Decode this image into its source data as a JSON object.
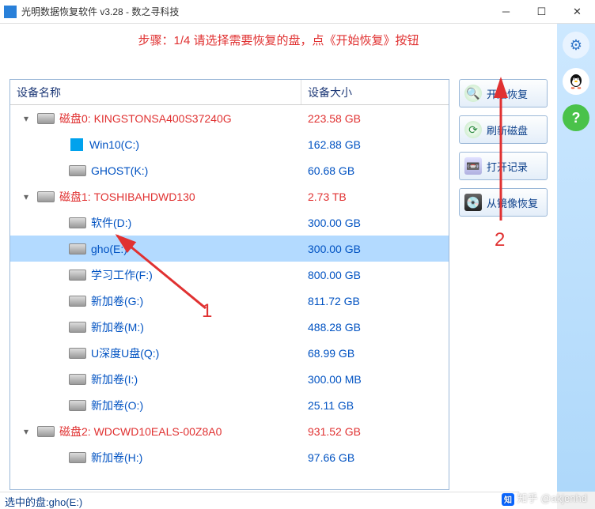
{
  "window": {
    "title": "光明数据恢复软件 v3.28 - 数之寻科技"
  },
  "step_text": "步骤：1/4 请选择需要恢复的盘，点《开始恢复》按钮",
  "columns": {
    "name": "设备名称",
    "size": "设备大小"
  },
  "tree": [
    {
      "type": "disk",
      "chev": "▾",
      "label": "磁盘0: KINGSTONSA400S37240G",
      "size": "223.58 GB",
      "indent": 0,
      "icon": "disk"
    },
    {
      "type": "part",
      "chev": "",
      "label": "Win10(C:)",
      "size": "162.88 GB",
      "indent": 1,
      "icon": "win"
    },
    {
      "type": "part",
      "chev": "",
      "label": "GHOST(K:)",
      "size": "60.68 GB",
      "indent": 1,
      "icon": "disk"
    },
    {
      "type": "disk",
      "chev": "▾",
      "label": "磁盘1: TOSHIBAHDWD130",
      "size": "2.73 TB",
      "indent": 0,
      "icon": "disk"
    },
    {
      "type": "part",
      "chev": "",
      "label": "软件(D:)",
      "size": "300.00 GB",
      "indent": 1,
      "icon": "disk"
    },
    {
      "type": "part",
      "chev": "",
      "label": "gho(E:)",
      "size": "300.00 GB",
      "indent": 1,
      "icon": "disk",
      "selected": true
    },
    {
      "type": "part",
      "chev": "",
      "label": "学习工作(F:)",
      "size": "800.00 GB",
      "indent": 1,
      "icon": "disk"
    },
    {
      "type": "part",
      "chev": "",
      "label": "新加卷(G:)",
      "size": "811.72 GB",
      "indent": 1,
      "icon": "disk"
    },
    {
      "type": "part",
      "chev": "",
      "label": "新加卷(M:)",
      "size": "488.28 GB",
      "indent": 1,
      "icon": "disk"
    },
    {
      "type": "part",
      "chev": "",
      "label": "U深度U盘(Q:)",
      "size": "68.99 GB",
      "indent": 1,
      "icon": "disk"
    },
    {
      "type": "part",
      "chev": "",
      "label": "新加卷(I:)",
      "size": "300.00 MB",
      "indent": 1,
      "icon": "disk"
    },
    {
      "type": "part",
      "chev": "",
      "label": "新加卷(O:)",
      "size": "25.11 GB",
      "indent": 1,
      "icon": "disk"
    },
    {
      "type": "disk",
      "chev": "▾",
      "label": "磁盘2: WDCWD10EALS-00Z8A0",
      "size": "931.52 GB",
      "indent": 0,
      "icon": "disk"
    },
    {
      "type": "part",
      "chev": "",
      "label": "新加卷(H:)",
      "size": "97.66 GB",
      "indent": 1,
      "icon": "disk"
    }
  ],
  "buttons": {
    "start": "开始恢复",
    "refresh": "刷新磁盘",
    "record": "打开记录",
    "mirror": "从镜像恢复"
  },
  "status": "选中的盘:gho(E:)",
  "annotations": {
    "one": "1",
    "two": "2"
  },
  "watermark": "知乎 @akjenhd"
}
